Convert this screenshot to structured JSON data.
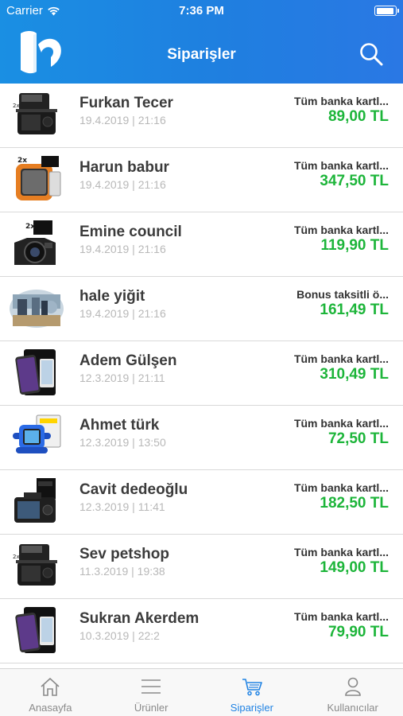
{
  "status_bar": {
    "carrier": "Carrier",
    "time": "7:36 PM",
    "battery_level": 0.95
  },
  "navbar": {
    "title": "Siparişler"
  },
  "orders": [
    {
      "name": "Furkan Tecer",
      "date": "19.4.2019 | 21:16",
      "payment": "Tüm banka kartl...",
      "amount": "89,00 TL",
      "thumb": "camera-cage"
    },
    {
      "name": "Harun babur",
      "date": "19.4.2019 | 21:16",
      "payment": "Tüm banka kartl...",
      "amount": "347,50 TL",
      "thumb": "screen-protector-orange"
    },
    {
      "name": "Emine council",
      "date": "19.4.2019 | 21:16",
      "payment": "Tüm banka kartl...",
      "amount": "119,90 TL",
      "thumb": "camera-lens"
    },
    {
      "name": "hale yiğit",
      "date": "19.4.2019 | 21:16",
      "payment": "Bonus taksitli ö...",
      "amount": "161,49 TL",
      "thumb": "photo-scene"
    },
    {
      "name": "Adem Gülşen",
      "date": "12.3.2019 | 21:11",
      "payment": "Tüm banka kartl...",
      "amount": "310,49 TL",
      "thumb": "phone-protector"
    },
    {
      "name": "Ahmet türk",
      "date": "12.3.2019 | 13:50",
      "payment": "Tüm banka kartl...",
      "amount": "72,50 TL",
      "thumb": "smartwatch"
    },
    {
      "name": "Cavit dedeoğlu",
      "date": "12.3.2019 | 11:41",
      "payment": "Tüm banka kartl...",
      "amount": "182,50 TL",
      "thumb": "camera-body"
    },
    {
      "name": "Sev petshop",
      "date": "11.3.2019 | 19:38",
      "payment": "Tüm banka kartl...",
      "amount": "149,00 TL",
      "thumb": "camera-cage"
    },
    {
      "name": "Sukran Akerdem",
      "date": "10.3.2019 | 22:2",
      "payment": "Tüm banka kartl...",
      "amount": "79,90 TL",
      "thumb": "phone-protector"
    }
  ],
  "tabbar": {
    "tabs": [
      {
        "label": "Anasayfa",
        "icon": "home-icon",
        "active": false
      },
      {
        "label": "Ürünler",
        "icon": "list-icon",
        "active": false
      },
      {
        "label": "Siparişler",
        "icon": "cart-icon",
        "active": true
      },
      {
        "label": "Kullanıcılar",
        "icon": "user-icon",
        "active": false
      }
    ]
  },
  "colors": {
    "header": "#1f82e3",
    "amount": "#1db53a",
    "active_tab": "#1f82e3",
    "inactive_tab": "#8a8a8a"
  }
}
